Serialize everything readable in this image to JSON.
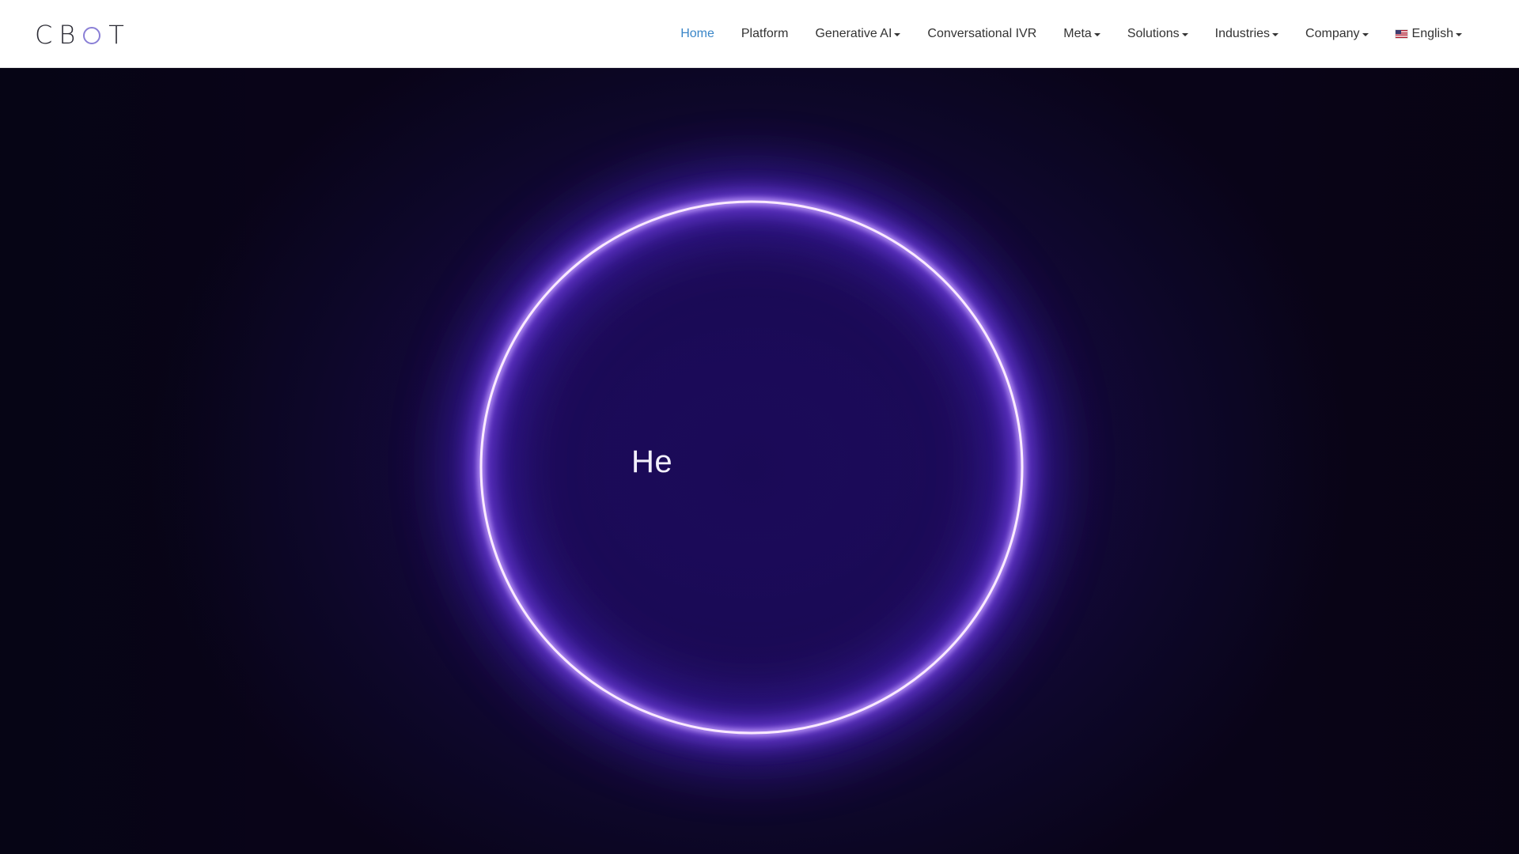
{
  "brand": {
    "letters": [
      "C",
      "B",
      "T"
    ],
    "accent_color": "#8a7fd6"
  },
  "nav": {
    "items": [
      {
        "label": "Home",
        "active": true,
        "dropdown": false
      },
      {
        "label": "Platform",
        "active": false,
        "dropdown": false
      },
      {
        "label": "Generative AI",
        "active": false,
        "dropdown": true
      },
      {
        "label": "Conversational IVR",
        "active": false,
        "dropdown": false
      },
      {
        "label": "Meta",
        "active": false,
        "dropdown": true
      },
      {
        "label": "Solutions",
        "active": false,
        "dropdown": true
      },
      {
        "label": "Industries",
        "active": false,
        "dropdown": true
      },
      {
        "label": "Company",
        "active": false,
        "dropdown": true
      }
    ],
    "language": {
      "label": "English",
      "icon": "us-flag-icon"
    },
    "active_color": "#3a86c8",
    "text_color": "#333333"
  },
  "hero": {
    "text": "He",
    "ring_color": "#8a4dff",
    "background_color": "#150840"
  }
}
